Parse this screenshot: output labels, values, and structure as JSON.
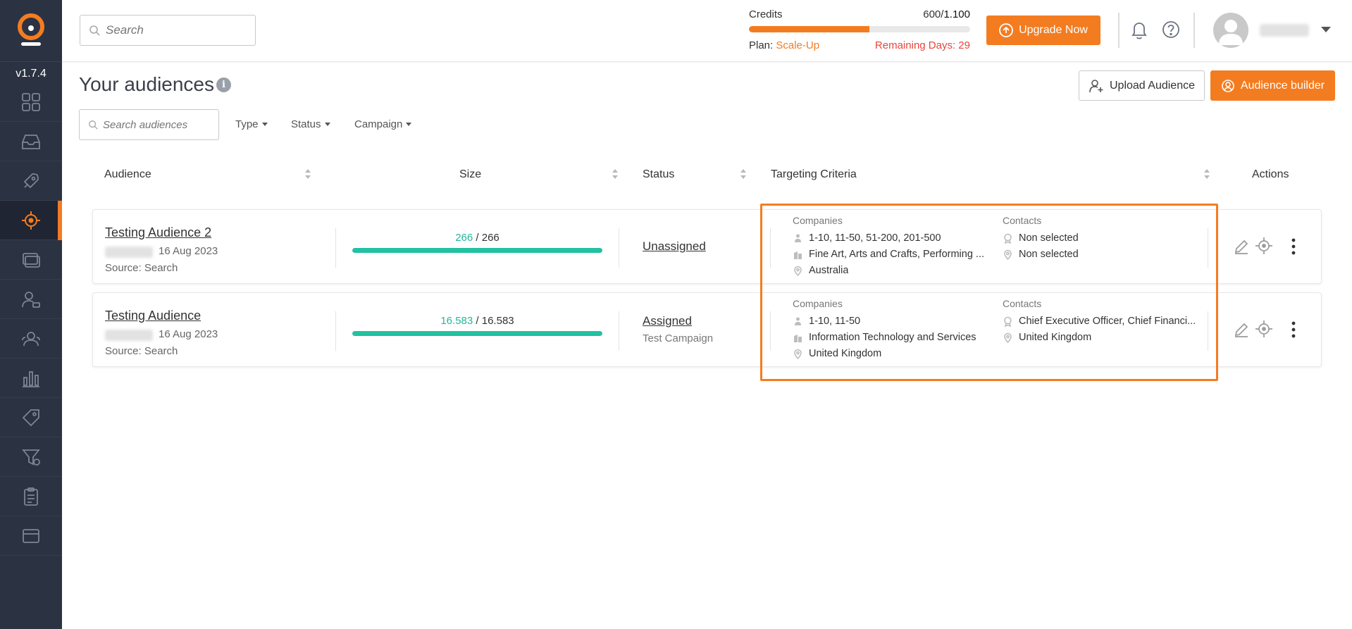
{
  "app": {
    "version": "v1.7.4"
  },
  "sidebar": {
    "items": [
      {
        "icon": "dashboard-icon"
      },
      {
        "icon": "inbox-icon"
      },
      {
        "icon": "rocket-icon"
      },
      {
        "icon": "target-icon",
        "active": true
      },
      {
        "icon": "cards-icon"
      },
      {
        "icon": "contact-icon"
      },
      {
        "icon": "team-icon"
      },
      {
        "icon": "bar-chart-icon"
      },
      {
        "icon": "tag-icon"
      },
      {
        "icon": "filter-icon"
      },
      {
        "icon": "clipboard-icon"
      },
      {
        "icon": "billing-icon"
      }
    ]
  },
  "header": {
    "search_placeholder": "Search",
    "credits": {
      "label": "Credits",
      "used": "600",
      "separator": "/",
      "total": "1.100",
      "fill_percent": 54.5,
      "plan_label": "Plan:",
      "plan_value": "Scale-Up",
      "remaining": "Remaining Days: 29"
    },
    "upgrade_label": "Upgrade Now"
  },
  "page": {
    "title": "Your audiences",
    "upload_label": "Upload Audience",
    "builder_label": "Audience builder",
    "search_placeholder": "Search audiences",
    "filters": {
      "type": "Type",
      "status": "Status",
      "campaign": "Campaign"
    }
  },
  "table": {
    "headers": {
      "audience": "Audience",
      "size": "Size",
      "status": "Status",
      "targeting": "Targeting Criteria",
      "actions": "Actions"
    },
    "companies_label": "Companies",
    "contacts_label": "Contacts",
    "rows": [
      {
        "name": "Testing Audience 2",
        "date": "16 Aug 2023",
        "source": "Source: Search",
        "size_current": "266",
        "size_sep": "/",
        "size_total": "266",
        "size_fill_percent": 100,
        "status": "Unassigned",
        "campaign": "",
        "companies": {
          "size": "1-10, 11-50, 51-200, 201-500",
          "industry": "Fine Art, Arts and Crafts, Performing ...",
          "location": "Australia"
        },
        "contacts": {
          "title": "Non selected",
          "location": "Non selected"
        }
      },
      {
        "name": "Testing Audience",
        "date": "16 Aug 2023",
        "source": "Source: Search",
        "size_current": "16.583",
        "size_sep": "/",
        "size_total": "16.583",
        "size_fill_percent": 100,
        "status": "Assigned",
        "campaign": "Test Campaign",
        "companies": {
          "size": "1-10, 11-50",
          "industry": "Information Technology and Services",
          "location": "United Kingdom"
        },
        "contacts": {
          "title": "Chief Executive Officer, Chief Financi...",
          "location": "United Kingdom"
        }
      }
    ]
  },
  "colors": {
    "accent": "#f47c20",
    "teal": "#22c1a1",
    "sidebar": "#2b3242",
    "danger": "#e8453c"
  }
}
